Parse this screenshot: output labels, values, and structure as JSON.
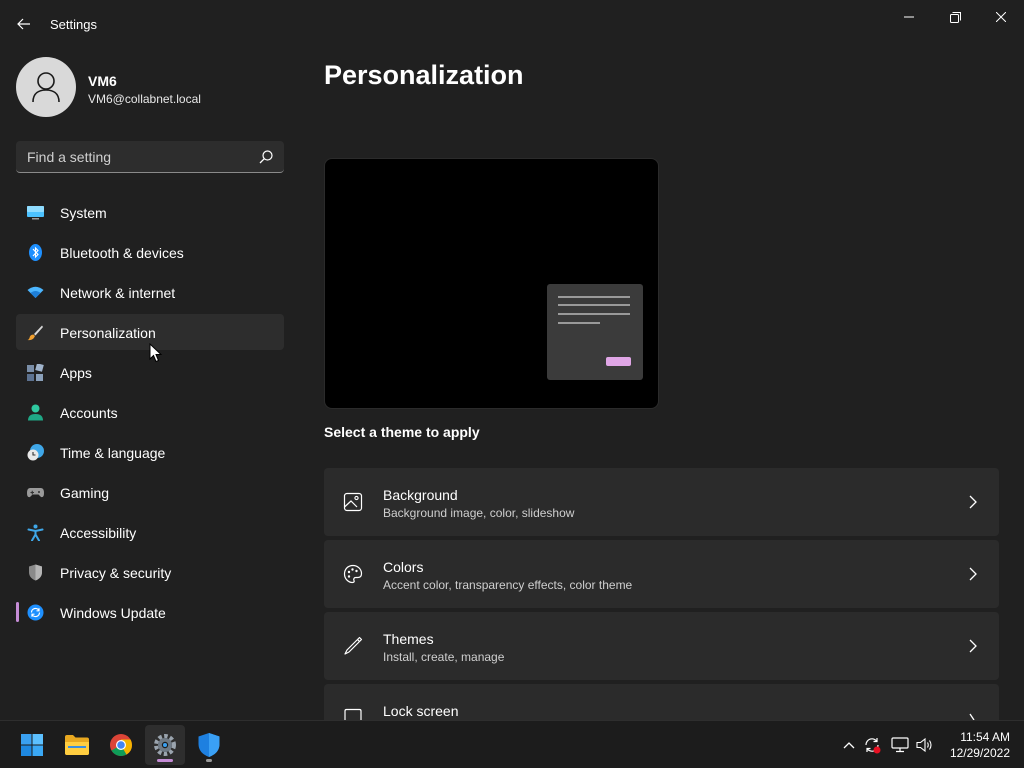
{
  "window": {
    "title": "Settings"
  },
  "profile": {
    "name": "VM6",
    "email": "VM6@collabnet.local"
  },
  "search": {
    "placeholder": "Find a setting"
  },
  "nav": {
    "items": [
      {
        "label": "System",
        "icon": "system-icon"
      },
      {
        "label": "Bluetooth & devices",
        "icon": "bluetooth-icon"
      },
      {
        "label": "Network & internet",
        "icon": "wifi-icon"
      },
      {
        "label": "Personalization",
        "icon": "brush-icon"
      },
      {
        "label": "Apps",
        "icon": "apps-icon"
      },
      {
        "label": "Accounts",
        "icon": "account-icon"
      },
      {
        "label": "Time & language",
        "icon": "clock-globe-icon"
      },
      {
        "label": "Gaming",
        "icon": "gamepad-icon"
      },
      {
        "label": "Accessibility",
        "icon": "accessibility-icon"
      },
      {
        "label": "Privacy & security",
        "icon": "shield-icon"
      },
      {
        "label": "Windows Update",
        "icon": "update-icon"
      }
    ],
    "hovered": "Personalization",
    "selected": "Windows Update"
  },
  "main": {
    "title": "Personalization",
    "theme_hint": "Select a theme to apply",
    "cards": [
      {
        "title": "Background",
        "subtitle": "Background image, color, slideshow",
        "icon": "image-icon"
      },
      {
        "title": "Colors",
        "subtitle": "Accent color, transparency effects, color theme",
        "icon": "palette-icon"
      },
      {
        "title": "Themes",
        "subtitle": "Install, create, manage",
        "icon": "pen-icon"
      },
      {
        "title": "Lock screen",
        "subtitle": "",
        "icon": "lock-screen-icon"
      }
    ]
  },
  "taskbar": {
    "apps": [
      "start-icon",
      "file-explorer-icon",
      "chrome-icon",
      "settings-icon",
      "windows-security-icon"
    ],
    "active_app": "settings-icon",
    "time": "11:54 AM",
    "date": "12/29/2022"
  },
  "colors": {
    "background": "#202020",
    "card": "#2b2b2b",
    "accent": "#c58cd6",
    "preview_button": "#e0a6e6"
  }
}
